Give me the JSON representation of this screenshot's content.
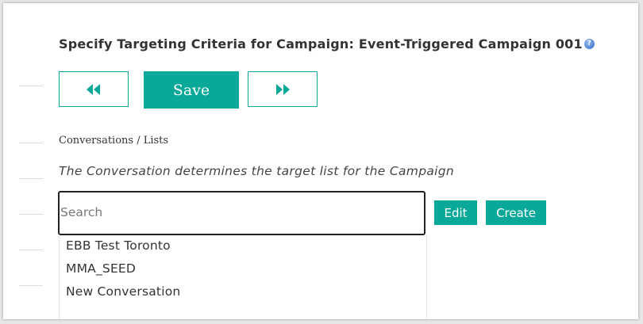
{
  "header": {
    "title": "Specify Targeting Criteria for Campaign: Event-Triggered Campaign 001",
    "help_glyph": "?"
  },
  "toolbar": {
    "back_icon": "double-left-arrow",
    "save_label": "Save",
    "forward_icon": "double-right-arrow"
  },
  "breadcrumb": "Conversations / Lists",
  "instruction": "The Conversation determines the target list for the Campaign",
  "search": {
    "placeholder": "Search",
    "value": ""
  },
  "actions": {
    "edit_label": "Edit",
    "create_label": "Create"
  },
  "conversations": [
    "EBB Test Toronto",
    "MMA_SEED",
    "New Conversation"
  ],
  "colors": {
    "accent": "#0aa899",
    "help_icon": "#3a6fcc"
  }
}
